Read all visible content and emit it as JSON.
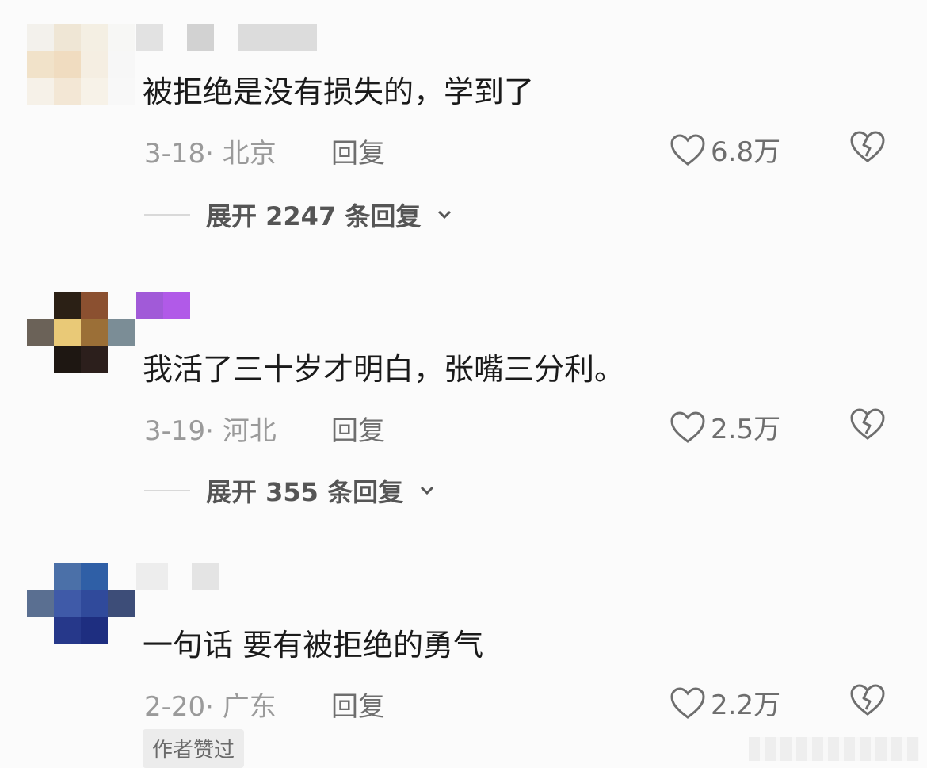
{
  "comments": [
    {
      "text": "被拒绝是没有损失的，学到了",
      "date_location": "3-18· 北京",
      "reply_label": "回复",
      "likes": "6.8万",
      "expand_label": "展开 2247 条回复",
      "avatar_colors": [
        "#f3f1ec",
        "#efe6d5",
        "#f4efe3",
        "#f7f7f5",
        "#f1e2c9",
        "#f0dcc0",
        "#f5eee2",
        "#f7f7f7",
        "#f6f1e8",
        "#f3e7d5",
        "#f7f2e8",
        "#f8f8f8"
      ],
      "username_colors": [
        "#e2e2e2",
        "#d2d2d2",
        "#dcdcdc"
      ]
    },
    {
      "text": "我活了三十岁才明白，张嘴三分利。",
      "date_location": "3-19· 河北",
      "reply_label": "回复",
      "likes": "2.5万",
      "expand_label": "展开 355 条回复",
      "avatar_colors": [
        "#fbfbfb",
        "#2b2015",
        "#8b5030",
        "#fbfbfb",
        "#6b6258",
        "#e9c977",
        "#9b6f37",
        "#7b8d96",
        "#fbfbfb",
        "#1e1712",
        "#2c1f1c",
        "#fbfbfb"
      ],
      "username_colors": [
        "#a15ad8",
        "#b15ae8"
      ]
    },
    {
      "text": "一句话 要有被拒绝的勇气",
      "date_location": "2-20· 广东",
      "reply_label": "回复",
      "likes": "2.2万",
      "author_badge": "作者赞过",
      "avatar_colors": [
        "#fbfbfb",
        "#4b70a8",
        "#2f5fa6",
        "#fbfbfb",
        "#5a6f91",
        "#3f5aa8",
        "#304a9b",
        "#3d4d78",
        "#fbfbfb",
        "#26388a",
        "#1e2e80",
        "#fbfbfb"
      ],
      "username_colors": [
        "#ededed",
        "#e4e4e4"
      ]
    }
  ],
  "icons": {
    "like": "heart-outline-icon",
    "dislike": "broken-heart-icon",
    "expand": "chevron-down-icon"
  },
  "colors": {
    "meta_gray": "#9a9a9a",
    "action_gray": "#6e6e6e",
    "background": "#fbfbfb"
  }
}
